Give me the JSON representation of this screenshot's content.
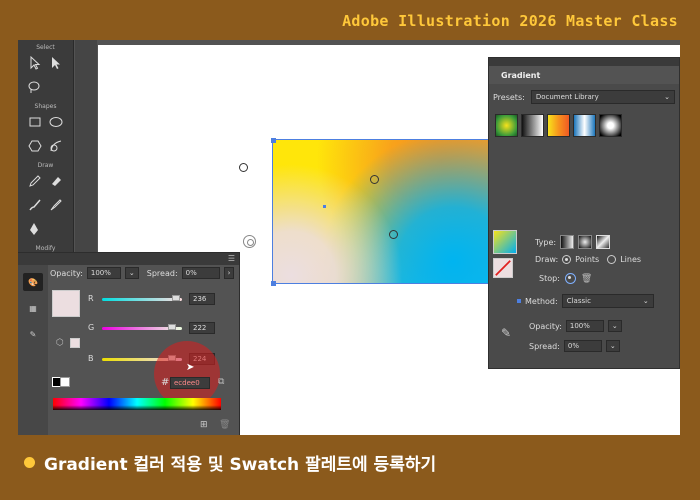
{
  "banner": {
    "title": "Adobe Illustration 2026 Master Class"
  },
  "toolbar": {
    "sections": {
      "select": "Select",
      "shapes": "Shapes",
      "draw": "Draw",
      "modify": "Modify"
    }
  },
  "gradient_panel": {
    "title": "Gradient",
    "presets_label": "Presets:",
    "presets_value": "Document Library",
    "type_label": "Type:",
    "draw_label": "Draw:",
    "draw_points": "Points",
    "draw_lines": "Lines",
    "stop_label": "Stop:",
    "method_label": "Method:",
    "method_value": "Classic",
    "opacity_label": "Opacity:",
    "opacity_value": "100%",
    "spread_label": "Spread:",
    "spread_value": "0%"
  },
  "color_panel": {
    "opacity_label": "Opacity:",
    "opacity_value": "100%",
    "spread_label": "Spread:",
    "spread_value": "0%",
    "r_label": "R",
    "r_value": "236",
    "r_level": 236,
    "g_label": "G",
    "g_value": "222",
    "g_level": 222,
    "b_label": "B",
    "b_value": "224",
    "b_level": 224,
    "hash": "#",
    "hex_value": "ecdee0",
    "selected_color": "#ecdee0"
  },
  "caption": {
    "text": "Gradient 컬러 적용 및 Swatch 팔레트에 등록하기"
  },
  "colors": {
    "accent": "#ffc83a",
    "background": "#8b5a1c",
    "selection": "#4d7fe0"
  }
}
